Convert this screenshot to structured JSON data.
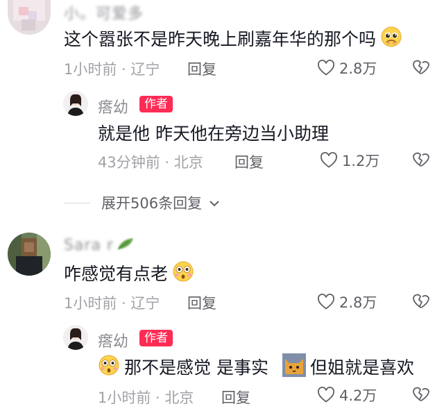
{
  "comments": [
    {
      "username": "小。可爱多",
      "text": "这个嚣张不是昨天晚上刷嘉年华的那个吗",
      "time_location": "1小时前 · 辽宁",
      "reply_label": "回复",
      "likes": "2.8万",
      "emoji": "pleading-face"
    },
    {
      "username": "瘩幼",
      "badge": "作者",
      "text": "就是他 昨天他在旁边当小助理",
      "time_location": "43分钟前 · 北京",
      "reply_label": "回复",
      "likes": "1.2万"
    },
    {
      "username": "Sara r",
      "text": "咋感觉有点老",
      "time_location": "1小时前 · 辽宁",
      "reply_label": "回复",
      "likes": "2.8万",
      "emoji": "flushed-face"
    },
    {
      "username": "瘩幼",
      "badge": "作者",
      "text_part1": "那不是感觉 是事实",
      "text_part2": "但姐就是喜欢",
      "time_location": "1小时前 · 北京",
      "reply_label": "回复",
      "likes": "4.2万",
      "emoji_1": "flushed-face",
      "emoji_2": "cat-face"
    }
  ],
  "expand_replies": "展开506条回复",
  "colors": {
    "badge": "#fe2c55",
    "meta": "#a1a2a7",
    "text": "#161823",
    "action": "#5f6066"
  },
  "icons": [
    "heart-outline-icon",
    "dislike-broken-heart-icon",
    "chevron-down-icon"
  ]
}
